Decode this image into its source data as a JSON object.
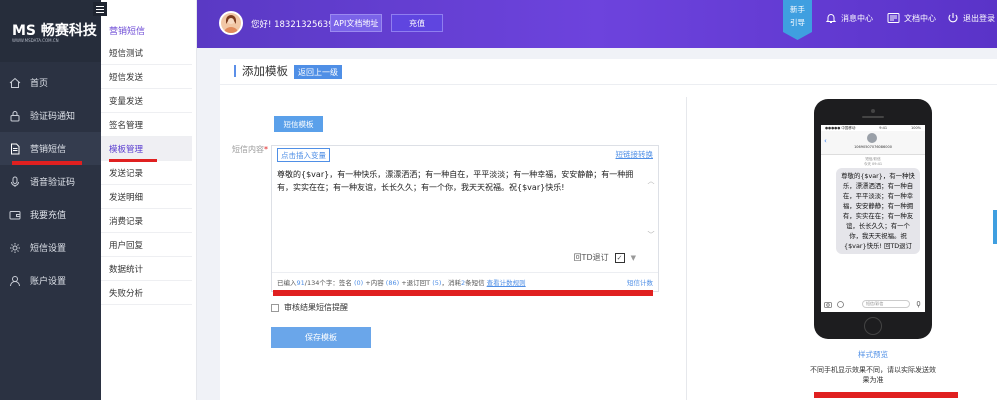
{
  "brand": {
    "logo_main": "MS 畅赛科技",
    "logo_sub": "WWW.MSDATA.COM.CN"
  },
  "sidebar": {
    "items": [
      {
        "label": "首页",
        "icon": "home-icon"
      },
      {
        "label": "验证码通知",
        "icon": "lock-icon"
      },
      {
        "label": "营销短信",
        "icon": "document-icon"
      },
      {
        "label": "语音验证码",
        "icon": "microphone-icon"
      },
      {
        "label": "我要充值",
        "icon": "wallet-icon"
      },
      {
        "label": "短信设置",
        "icon": "settings-icon"
      },
      {
        "label": "账户设置",
        "icon": "user-icon"
      }
    ],
    "active_index": 2
  },
  "submenu": {
    "title": "营销短信",
    "items": [
      "短信测试",
      "短信发送",
      "变量发送",
      "签名管理",
      "模板管理",
      "发送记录",
      "发送明细",
      "消费记录",
      "用户回复",
      "数据统计",
      "失败分析"
    ],
    "active_index": 4
  },
  "topbar": {
    "greeting": "您好! 18321325639",
    "api_doc": "API文档地址",
    "recharge": "充值",
    "guide_line1": "新手",
    "guide_line2": "引导",
    "messages": "消息中心",
    "docs": "文档中心",
    "logout": "退出登录"
  },
  "page": {
    "title": "添加模板",
    "back": "返回上一级",
    "template_button": "短信模板",
    "content_label": "短信内容",
    "required_mark": "*",
    "insert_variable": "点击插入变量",
    "short_link": "短链接转换",
    "message_text": "尊敬的{$var}，有一种快乐，漂漂洒洒；有一种自在，平平淡淡；有一种幸福，安安静静；有一种拥有，实实在在；有一种友谊，长长久久；有一个你，我天天祝福。祝{$var}快乐!",
    "unsubscribe_label": "回TD退订",
    "unsubscribe_checked": true,
    "counter": {
      "prefix": "已编入",
      "entered": "91",
      "mid1": "/134个字：签名",
      "sign": "(0)",
      "mid2": "+内容",
      "content": "(86)",
      "mid3": "+退订回T",
      "unsub": "(5)",
      "mid4": "，消耗",
      "cost": "2",
      "mid5": "条短信",
      "rules_link": "查看计数规则",
      "count_label": "短信计数"
    },
    "review_label": "审核结果短信提醒",
    "review_checked": false,
    "save": "保存模板"
  },
  "phone": {
    "status_left": "●●●●● 中国移动",
    "status_time": "9:41",
    "status_right": "100%",
    "back_glyph": "‹",
    "number": "10690507076086000",
    "meta_line1": "短信/彩信",
    "meta_line2": "今天 09:41",
    "bubble": "尊敬的{$var}，有一种快乐，漂漂洒洒；有一种自在，平平淡淡；有一种幸福，安安静静；有一种拥有，实实在在；有一种友谊，长长久久；有一个你，我天天祝福。祝{$var}快乐! 回TD退订",
    "input_placeholder": "短信/彩信"
  },
  "preview": {
    "label": "样式预览",
    "note": "不同手机显示效果不同，请以实际发送效果为准"
  },
  "colors": {
    "accent": "#4f8fe6",
    "topbar": "#6d43dd",
    "sidebar": "#2b3242",
    "highlight_red": "#e02020"
  }
}
